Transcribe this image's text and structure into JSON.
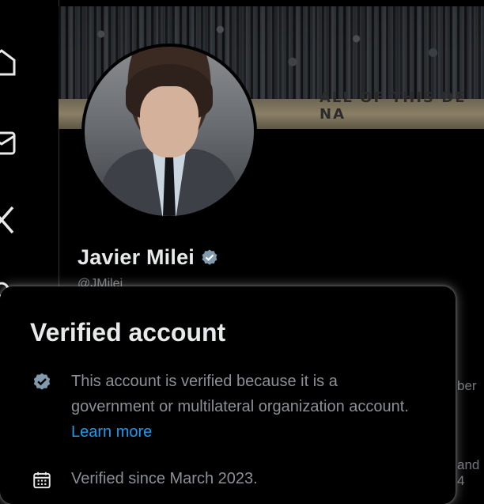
{
  "profile": {
    "name": "Javier Milei",
    "handle": "@JMilei"
  },
  "peek": {
    "line1": "ber",
    "line2": "and 4"
  },
  "verified_card": {
    "title": "Verified account",
    "description": "This account is verified because it is a government or multilateral organization account.",
    "learn_more": "Learn more",
    "since": "Verified since March 2023."
  },
  "banner": {
    "graffiti": "ALL OF THIS DE NA"
  },
  "colors": {
    "background": "#000000",
    "badge_gray": "#829aab",
    "link_blue": "#1d9bf0",
    "text_primary": "#e7e9ea",
    "text_secondary": "#8b9096"
  },
  "icons": {
    "verified": "verified-badge-icon",
    "calendar": "calendar-icon"
  }
}
